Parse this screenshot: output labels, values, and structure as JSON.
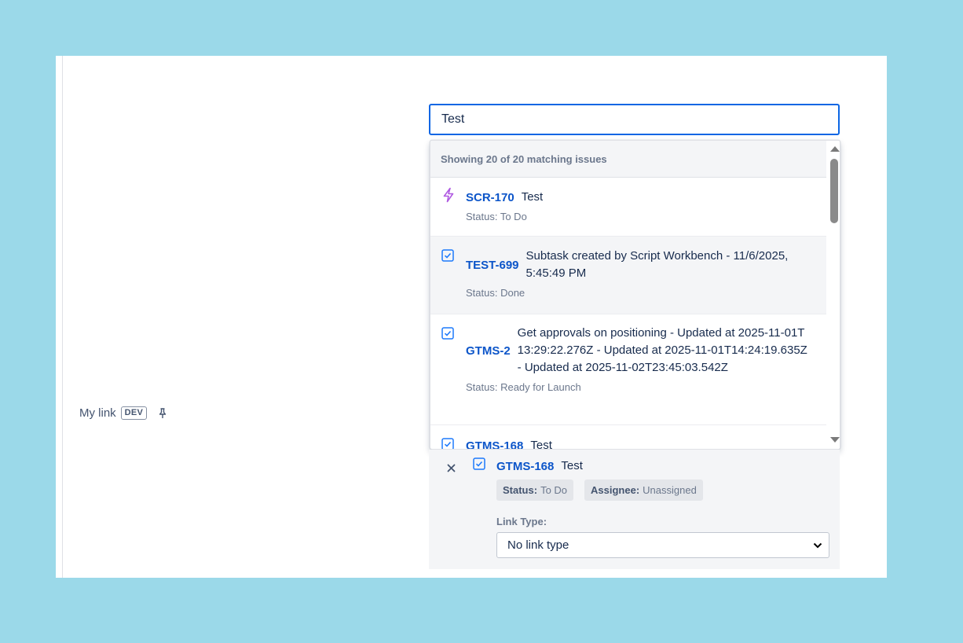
{
  "field": {
    "label": "My link",
    "badge": "DEV"
  },
  "search": {
    "value": "Test"
  },
  "dropdown": {
    "header": "Showing 20 of 20 matching issues",
    "issues": [
      {
        "key": "SCR-170",
        "summary": "Test",
        "status": "Status: To Do",
        "type_icon": "lightning-icon"
      },
      {
        "key": "TEST-699",
        "summary": "Subtask created by Script Workbench - 11/6/2025, 5:45:49 PM",
        "status": "Status: Done",
        "type_icon": "checkbox-icon"
      },
      {
        "key": "GTMS-2",
        "summary": "Get approvals on positioning - Updated at 2025-11-01T13:29:22.276Z - Updated at 2025-11-01T14:24:19.635Z - Updated at 2025-11-02T23:45:03.542Z",
        "status": "Status: Ready for Launch",
        "type_icon": "checkbox-icon"
      },
      {
        "key": "GTMS-168",
        "summary": "Test",
        "status": "",
        "type_icon": "checkbox-icon"
      }
    ]
  },
  "linked": {
    "key": "GTMS-168",
    "summary": "Test",
    "status_label": "Status:",
    "status_value": "To Do",
    "assignee_label": "Assignee:",
    "assignee_value": "Unassigned",
    "link_type_label": "Link Type:",
    "link_type_value": "No link type"
  },
  "colors": {
    "background": "#9bd9e9",
    "focus": "#0c66e4",
    "link": "#0c55c9",
    "check_icon": "#1d7afc",
    "lightning_icon": "#af59e1"
  }
}
